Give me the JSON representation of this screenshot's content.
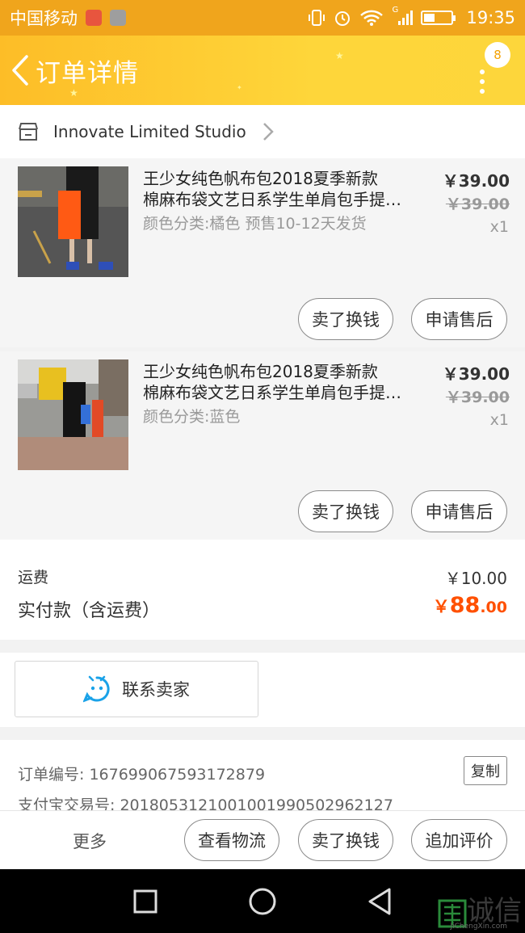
{
  "status_bar": {
    "carrier": "中国移动",
    "time": "19:35",
    "network_label": "G"
  },
  "nav": {
    "title": "订单详情",
    "badge_count": "8"
  },
  "shop": {
    "name": "Innovate Limited Studio"
  },
  "items": [
    {
      "title_line1": "王少女纯色帆布包2018夏季新款",
      "title_line2": "棉麻布袋文艺日系学生单肩包手提女包",
      "sku": "颜色分类:橘色 预售10-12天发货",
      "price": "￥39.00",
      "original_price": "￥39.00",
      "quantity": "x1",
      "btn_resell": "卖了换钱",
      "btn_aftersale": "申请售后"
    },
    {
      "title_line1": "王少女纯色帆布包2018夏季新款",
      "title_line2": "棉麻布袋文艺日系学生单肩包手提女包",
      "sku": "颜色分类:蓝色",
      "price": "￥39.00",
      "original_price": "￥39.00",
      "quantity": "x1",
      "btn_resell": "卖了换钱",
      "btn_aftersale": "申请售后"
    }
  ],
  "summary": {
    "shipping_label": "运费",
    "shipping_value": "￥10.00",
    "total_label": "实付款（含运费）",
    "total_currency": "￥",
    "total_integer": "88",
    "total_decimal": ".00"
  },
  "contact": {
    "label": "联系卖家"
  },
  "order_info": {
    "order_number": "订单编号: 167699067593172879",
    "alipay_number": "支付宝交易号: 2018053121001001990502962127",
    "copy_label": "复制"
  },
  "bottom_bar": {
    "more": "更多",
    "logistics": "查看物流",
    "resell": "卖了换钱",
    "review": "追加评价"
  },
  "watermark": {
    "text": "诚信",
    "url": "JiChengXin.com"
  },
  "colors": {
    "accent_orange": "#ff5000",
    "nav_yellow": "#fed63a",
    "status_orange": "#f0a51c"
  }
}
